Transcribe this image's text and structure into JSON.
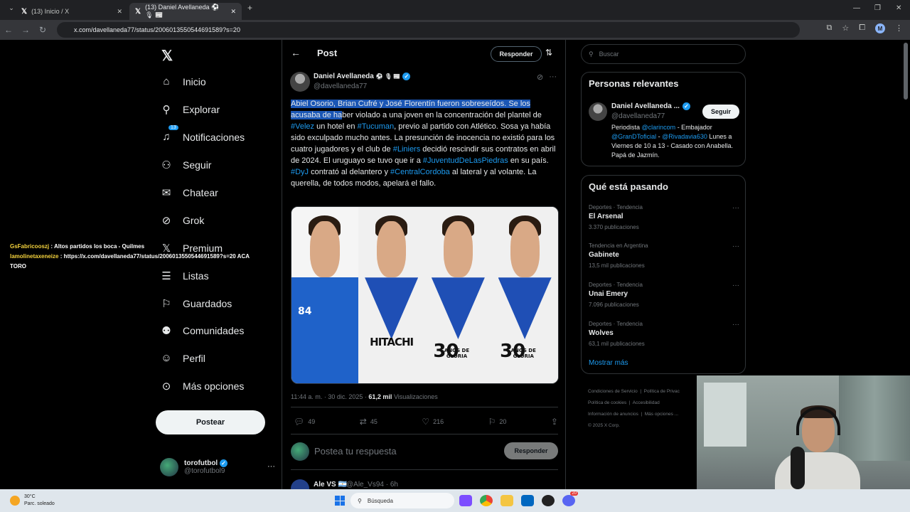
{
  "browser": {
    "tabs": [
      {
        "title": "(13) Inicio / X"
      },
      {
        "title": "(13) Daniel Avellaneda ⚽ 🎙 📰"
      }
    ],
    "url": "x.com/davellaneda77/status/2006013550544691589?s=20",
    "profile_initial": "M"
  },
  "nav": {
    "items": [
      {
        "label": "Inicio",
        "icon": "home-icon"
      },
      {
        "label": "Explorar",
        "icon": "search-icon"
      },
      {
        "label": "Notificaciones",
        "icon": "bell-icon"
      },
      {
        "label": "Seguir",
        "icon": "follow-icon"
      },
      {
        "label": "Chatear",
        "icon": "mail-icon"
      },
      {
        "label": "Grok",
        "icon": "grok-icon"
      },
      {
        "label": "Premium",
        "icon": "x-premium-icon"
      },
      {
        "label": "Listas",
        "icon": "list-icon"
      },
      {
        "label": "Guardados",
        "icon": "bookmark-icon"
      },
      {
        "label": "Comunidades",
        "icon": "communities-icon"
      },
      {
        "label": "Perfil",
        "icon": "profile-icon"
      },
      {
        "label": "Más opciones",
        "icon": "more-icon"
      }
    ],
    "notif_badge": "13",
    "post_button": "Postear",
    "account": {
      "name": "torofutbol",
      "handle": "@torofutbol9"
    }
  },
  "chat_overlay": [
    {
      "user": "GsFabricooszj",
      "text": ": Altos partidos los boca - Quilmes"
    },
    {
      "user": "lamolinetaxeneize",
      "text": ": https://x.com/davellaneda77/status/2006013550544691589?s=20 ACA TORO"
    }
  ],
  "post": {
    "header_title": "Post",
    "reply_label": "Responder",
    "author_name": "Daniel Avellaneda",
    "author_emoji": "⚽ 🎙 📰",
    "author_handle": "@davellaneda77",
    "text": {
      "highlight": "Abiel Osorio, Brian Cufré y José Florentín fueron sobreseídos. Se los acusaba de ha",
      "p1": "ber violado a una joven en la concentración del plantel de ",
      "tag1": "#Velez",
      "p2": " un hotel en ",
      "tag2": "#Tucuman",
      "p3": ", previo al partido con Atlético. Sosa ya había sido exculpado mucho antes. La presunción de inocencia no existió para los cuatro jugadores y el club de ",
      "tag3": "#Liniers",
      "p4": " decidió rescindir sus contratos en abril de 2024. El uruguayo se tuvo que ir a ",
      "tag4": "#JuventudDeLasPiedras",
      "p5": " en su país. ",
      "tag5": "#DyJ",
      "p6": " contrató al delantero y ",
      "tag6": "#CentralCordoba",
      "p7": " al lateral y al volante. La querella, de todos modos, apelará el fallo."
    },
    "image_texts": {
      "sponsor": "HITACHI",
      "jersey1": "84",
      "anniv_num": "30",
      "anniv_text": "AÑOS DE GLORIA"
    },
    "time": "11:44 a. m. · 30 dic. 2025 · ",
    "views": "61,2 mil",
    "views_label": " Visualizaciones",
    "stats": {
      "replies": "49",
      "reposts": "45",
      "likes": "216",
      "bookmarks": "20"
    },
    "reply_placeholder": "Postea tu respuesta",
    "reply_button": "Responder",
    "next": {
      "name": "Ale VS 🇦🇷",
      "handle": "@Ale_Vs94 · 6h"
    }
  },
  "sidebar": {
    "search_placeholder": "Buscar",
    "relevant_title": "Personas relevantes",
    "relevant": {
      "name": "Daniel Avellaneda ...",
      "handle": "@davellaneda77",
      "follow": "Seguir",
      "bio1": "Periodista ",
      "bio_link1": "@clarincom",
      "bio2": " - Embajador ",
      "bio_link2": "@GranDToficial",
      "bio3": " - ",
      "bio_link3": "@Rivadavia630",
      "bio4": " Lunes a Viernes de 10 a 13 - Casado con Anabella. Papá de Jazmín."
    },
    "trends_title": "Qué está pasando",
    "trends": [
      {
        "category": "Deportes · Tendencia",
        "name": "El Arsenal",
        "count": "3.370 publicaciones"
      },
      {
        "category": "Tendencia en Argentina",
        "name": "Gabinete",
        "count": "13,5 mil publicaciones"
      },
      {
        "category": "Deportes · Tendencia",
        "name": "Unai Emery",
        "count": "7.096 publicaciones"
      },
      {
        "category": "Deportes · Tendencia",
        "name": "Wolves",
        "count": "63,1 mil publicaciones"
      }
    ],
    "show_more": "Mostrar más",
    "footer": [
      "Condiciones de Servicio",
      "Política de Privac",
      "Política de cookies",
      "Accesibilidad",
      "Información de anuncios",
      "Más opciones ...",
      "© 2025 X Corp."
    ]
  },
  "taskbar": {
    "weather_temp": "30°C",
    "weather_desc": "Parc. soleado",
    "search": "Búsqueda",
    "notif": "20"
  }
}
